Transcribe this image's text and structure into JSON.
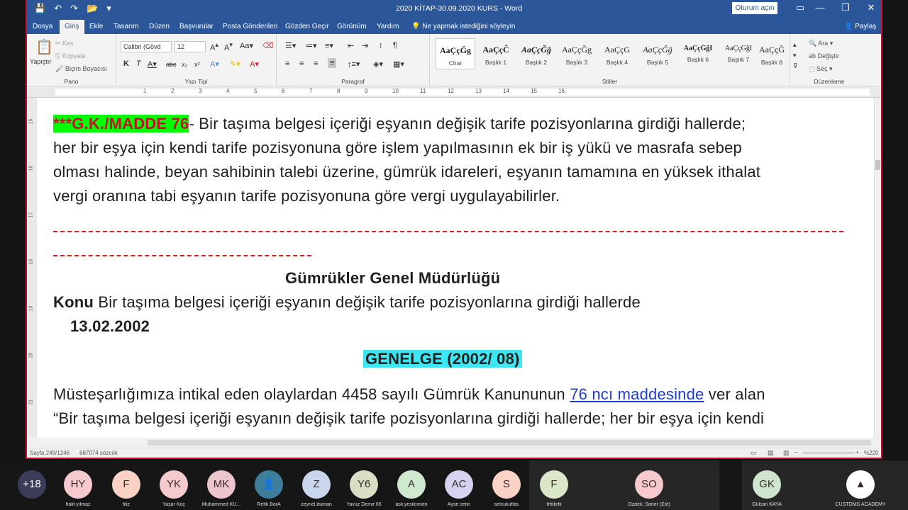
{
  "window": {
    "title": "2020 KİTAP-30.09.2020   KURS  -  Word",
    "signin": "Oturum açın",
    "min": "—",
    "restore": "❐",
    "close": "✕"
  },
  "tabs": [
    "Dosya",
    "Giriş",
    "Ekle",
    "Tasarım",
    "Düzen",
    "Başvurular",
    "Posta Gönderileri",
    "Gözden Geçir",
    "Görünüm",
    "Yardım"
  ],
  "tell_me": "Ne yapmak istediğini söyleyin",
  "share": "Paylaş",
  "ribbon": {
    "pano": {
      "paste": "Yapıştır",
      "cut": "Kes",
      "copy": "Kopyala",
      "format_painter": "Biçim Boyacısı",
      "label": "Pano"
    },
    "font": {
      "name": "Calibri (Gövd",
      "size": "12",
      "label": "Yazı Tipi"
    },
    "paragraph": {
      "label": "Paragraf"
    },
    "styles": {
      "label": "Stiller",
      "items": [
        {
          "preview": "AaÇçĞg",
          "name": "Char"
        },
        {
          "preview": "AaÇçĈ",
          "name": "Başlık 1"
        },
        {
          "preview": "AaÇçĞğ",
          "name": "Başlık 2"
        },
        {
          "preview": "AaÇçĞg",
          "name": "Başlık 3"
        },
        {
          "preview": "AaÇçG",
          "name": "Başlık 4"
        },
        {
          "preview": "AaÇçĞğ",
          "name": "Başlık 5"
        },
        {
          "preview": "AaÇçĞğI",
          "name": "Başlık 6"
        },
        {
          "preview": "AaÇçĞğI",
          "name": "Başlık 7"
        },
        {
          "preview": "AaÇçĞg",
          "name": "Başlık 8"
        }
      ]
    },
    "editing": {
      "find": "Ara",
      "replace": "Değiştir",
      "select": "Seç",
      "label": "Düzenleme"
    }
  },
  "ruler": {
    "marks": [
      "1",
      "2",
      "3",
      "4",
      "5",
      "6",
      "7",
      "8",
      "9",
      "10",
      "11",
      "12",
      "13",
      "14",
      "15",
      "16"
    ]
  },
  "vruler": {
    "marks": [
      "15",
      "16",
      "17",
      "18",
      "19",
      "20",
      "21"
    ]
  },
  "document": {
    "madde_tag": "***G.K./MADDE 76",
    "line1_rest": "- Bir taşıma belgesi içeriği eşyanın değişik tarife pozisyonlarına girdiği hallerde;",
    "line2": "her bir eşya için kendi tarife pozisyonuna göre işlem yapılmasının ek bir iş yükü ve masrafa sebep",
    "line3": "olması halinde, beyan sahibinin talebi üzerine, gümrük idareleri, eşyanın tamamına en yüksek ithalat",
    "line4": "vergi oranına tabi eşyanın tarife pozisyonuna göre vergi uygulayabilirler.",
    "heading": "Gümrükler Genel Müdürlüğü",
    "konu_label": "Konu",
    "konu_text": " Bir taşıma belgesi içeriği eşyanın değişik tarife pozisyonlarına girdiği hallerde",
    "date": "13.02.2002",
    "genelge": "GENELGE  (2002/ 08)",
    "body1_a": "Müsteşarlığımıza intikal eden olaylardan 4458 sayılı Gümrük Kanununun ",
    "body1_link": "76 ncı maddesinde",
    "body1_b": " ver alan",
    "body2": "“Bir taşıma belgesi içeriği eşyanın değişik tarife pozisyonlarına girdiği hallerde; her bir eşya için kendi"
  },
  "status": {
    "page": "Sayfa 249/1246",
    "words": "687074 sözcük",
    "zoom": "%220"
  },
  "participants": [
    {
      "initials": "+18",
      "name": "",
      "color": "#3b3b5a"
    },
    {
      "initials": "HY",
      "name": "halit yılmaz",
      "color": "#f6c9cf"
    },
    {
      "initials": "F",
      "name": "filiz",
      "color": "#fbd2c6"
    },
    {
      "initials": "YK",
      "name": "Yaşar Koç",
      "color": "#f6c9cf"
    },
    {
      "initials": "MK",
      "name": "Muhammed KU...",
      "color": "#ecc6cc"
    },
    {
      "initials": "",
      "name": "Refik BorA",
      "color": "#3d7f9a"
    },
    {
      "initials": "Z",
      "name": "zeynel.duman",
      "color": "#c9d6ee"
    },
    {
      "initials": "Y6",
      "name": "Yavuz Demir 65",
      "color": "#d9dfc4"
    },
    {
      "initials": "A",
      "name": "asli.yesilcimen",
      "color": "#cfe9cf"
    },
    {
      "initials": "AC",
      "name": "Ayse cetin",
      "color": "#d5d3f0"
    },
    {
      "initials": "S",
      "name": "selcukuflas",
      "color": "#fbd2c6"
    },
    {
      "initials": "F",
      "name": "frhtkrtli",
      "color": "#d9e6c7"
    },
    {
      "initials": "SO",
      "name": "Ozdek, Soner (Ext)",
      "color": "#f6c9cf"
    },
    {
      "initials": "GK",
      "name": "Gülcan KAYA",
      "color": "#cfe4cf"
    },
    {
      "initials": "",
      "name": "CUSTOMS ACADEMY",
      "color": "#ffffff"
    }
  ]
}
